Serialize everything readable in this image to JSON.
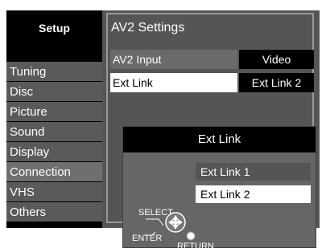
{
  "sidebar": {
    "title": "Setup",
    "items": [
      {
        "label": "Tuning"
      },
      {
        "label": "Disc"
      },
      {
        "label": "Picture"
      },
      {
        "label": "Sound"
      },
      {
        "label": "Display"
      },
      {
        "label": "Connection"
      },
      {
        "label": "VHS"
      },
      {
        "label": "Others"
      }
    ],
    "selected_index": 5
  },
  "panel": {
    "title": "AV2 Settings",
    "rows": [
      {
        "label": "AV2 Input",
        "value": "Video"
      },
      {
        "label": "Ext Link",
        "value": "Ext Link 2"
      }
    ]
  },
  "popup": {
    "title": "Ext Link",
    "options": [
      "Ext Link 1",
      "Ext Link 2"
    ],
    "selected_index": 1
  },
  "controls": {
    "select_label": "SELECT",
    "enter_label": "ENTER",
    "return_label": "RETURN"
  },
  "colors": {
    "background": "#ffffff",
    "panel": "#555555",
    "menu_item": "#5a5a5a",
    "highlight": "#ffffff"
  }
}
